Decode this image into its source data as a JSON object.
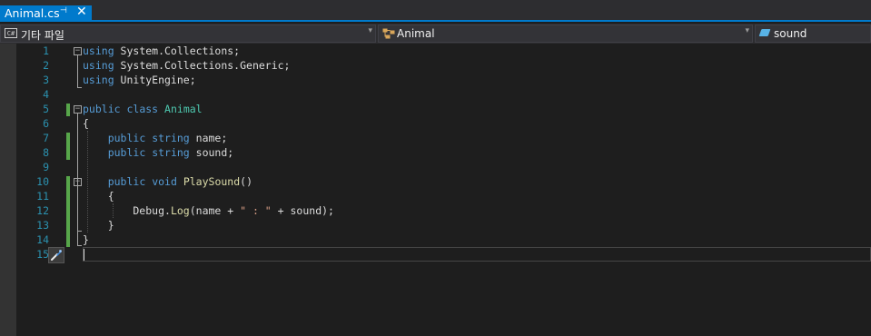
{
  "tab": {
    "title": "Animal.cs",
    "pin": "⊣",
    "close": "✕",
    "accent": "#007acc"
  },
  "nav": {
    "file_context": "기타 파일",
    "file_icon": "C#",
    "type_name": "Animal",
    "member_name": "sound"
  },
  "lines": [
    {
      "n": "1",
      "tokens": [
        {
          "t": "using",
          "c": "kw"
        },
        {
          "t": " System.Collections;",
          "c": "plain"
        }
      ]
    },
    {
      "n": "2",
      "tokens": [
        {
          "t": "using",
          "c": "kw"
        },
        {
          "t": " System.Collections.Generic;",
          "c": "plain"
        }
      ]
    },
    {
      "n": "3",
      "tokens": [
        {
          "t": "using",
          "c": "kw"
        },
        {
          "t": " UnityEngine;",
          "c": "plain"
        }
      ]
    },
    {
      "n": "4",
      "tokens": []
    },
    {
      "n": "5",
      "tokens": [
        {
          "t": "public",
          "c": "kw"
        },
        {
          "t": " ",
          "c": "plain"
        },
        {
          "t": "class",
          "c": "kw"
        },
        {
          "t": " ",
          "c": "plain"
        },
        {
          "t": "Animal",
          "c": "type"
        }
      ]
    },
    {
      "n": "6",
      "tokens": [
        {
          "t": "{",
          "c": "plain"
        }
      ]
    },
    {
      "n": "7",
      "tokens": [
        {
          "t": "    ",
          "c": "plain"
        },
        {
          "t": "public",
          "c": "kw"
        },
        {
          "t": " ",
          "c": "plain"
        },
        {
          "t": "string",
          "c": "kw"
        },
        {
          "t": " name;",
          "c": "plain"
        }
      ]
    },
    {
      "n": "8",
      "tokens": [
        {
          "t": "    ",
          "c": "plain"
        },
        {
          "t": "public",
          "c": "kw"
        },
        {
          "t": " ",
          "c": "plain"
        },
        {
          "t": "string",
          "c": "kw"
        },
        {
          "t": " sound;",
          "c": "plain"
        }
      ]
    },
    {
      "n": "9",
      "tokens": []
    },
    {
      "n": "10",
      "tokens": [
        {
          "t": "    ",
          "c": "plain"
        },
        {
          "t": "public",
          "c": "kw"
        },
        {
          "t": " ",
          "c": "plain"
        },
        {
          "t": "void",
          "c": "kw"
        },
        {
          "t": " ",
          "c": "plain"
        },
        {
          "t": "PlaySound",
          "c": "method"
        },
        {
          "t": "()",
          "c": "plain"
        }
      ]
    },
    {
      "n": "11",
      "tokens": [
        {
          "t": "    {",
          "c": "plain"
        }
      ]
    },
    {
      "n": "12",
      "tokens": [
        {
          "t": "        Debug.",
          "c": "plain"
        },
        {
          "t": "Log",
          "c": "method"
        },
        {
          "t": "(name + ",
          "c": "plain"
        },
        {
          "t": "\" : \"",
          "c": "str"
        },
        {
          "t": " + sound);",
          "c": "plain"
        }
      ]
    },
    {
      "n": "13",
      "tokens": [
        {
          "t": "    }",
          "c": "plain"
        }
      ]
    },
    {
      "n": "14",
      "tokens": [
        {
          "t": "}",
          "c": "plain"
        }
      ]
    },
    {
      "n": "15",
      "tokens": []
    }
  ],
  "colors": {
    "keyword": "#569cd6",
    "type": "#4ec9b0",
    "method": "#dcdcaa",
    "string": "#d69d85",
    "linenumber": "#2b91af",
    "change_marker": "#57a64a"
  },
  "icons": {
    "lightbulb": "quick-actions-screwdriver-icon",
    "type": "class-icon",
    "member": "field-icon"
  }
}
